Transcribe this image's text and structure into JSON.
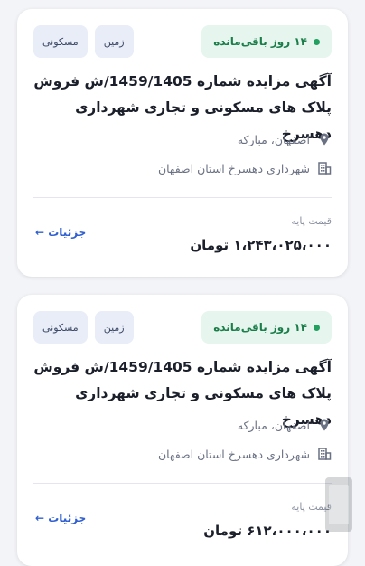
{
  "cards": [
    {
      "days_left": "۱۴ روز باقی‌مانده",
      "tags": [
        "مسکونی",
        "زمین"
      ],
      "title": "آگهی مزایده شماره 1459/1405/ش فروش پلاک های  مسکونی و تجاری شهرداری دهسرخ",
      "location": "اصفهان، مبارکه",
      "organization": "شهرداری دهسرخ استان اصفهان",
      "price_label": "قیمت پایه",
      "price": "۱،۲۴۳،۰۲۵،۰۰۰ تومان",
      "details_label": "جزئیات ←"
    },
    {
      "days_left": "۱۴ روز باقی‌مانده",
      "tags": [
        "مسکونی",
        "زمین"
      ],
      "title": "آگهی مزایده شماره 1459/1405/ش فروش پلاک های  مسکونی و تجاری شهرداری دهسرخ",
      "location": "اصفهان، مبارکه",
      "organization": "شهرداری دهسرخ استان اصفهان",
      "price_label": "قیمت پایه",
      "price": "۶۱۲،۰۰۰،۰۰۰ تومان",
      "details_label": "جزئیات ←"
    }
  ],
  "colors": {
    "accent": "#2f5fd0",
    "badge_bg": "#e6f6ee",
    "badge_text": "#1b7d4a",
    "tag_bg": "#e8edf8"
  },
  "icons": [
    "location-pin-icon",
    "building-icon",
    "status-dot-icon"
  ]
}
